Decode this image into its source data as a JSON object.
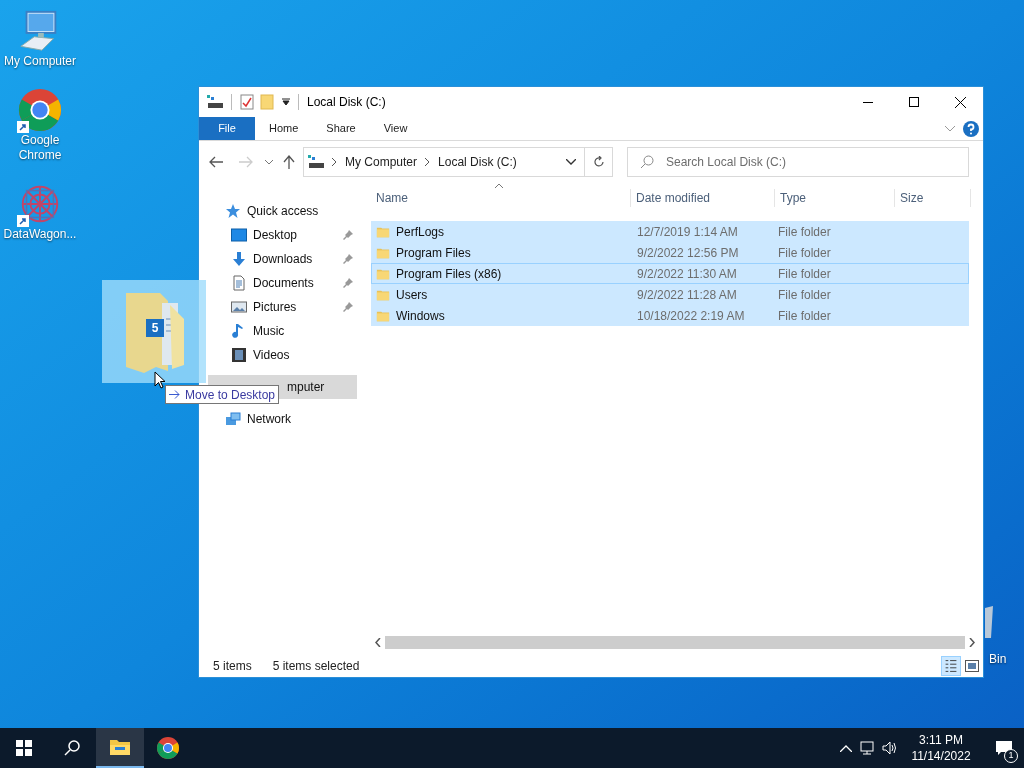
{
  "desktop_icons": [
    {
      "kind": "computer",
      "label": "My Computer"
    },
    {
      "kind": "chrome",
      "label": "Google Chrome"
    },
    {
      "kind": "datawagon",
      "label": "DataWagon..."
    }
  ],
  "recycle_bin": {
    "label": "Bin"
  },
  "window": {
    "title": "Local Disk (C:)",
    "ribbon_tabs": [
      {
        "label": "File",
        "selected": true
      },
      {
        "label": "Home",
        "selected": false
      },
      {
        "label": "Share",
        "selected": false
      },
      {
        "label": "View",
        "selected": false
      }
    ],
    "breadcrumbs": [
      "My Computer",
      "Local Disk (C:)"
    ],
    "search": {
      "placeholder": "Search Local Disk (C:)"
    },
    "nav": [
      {
        "kind": "star",
        "label": "Quick access",
        "selected": false,
        "children": [
          {
            "kind": "desktop",
            "label": "Desktop",
            "pinned": true,
            "selected": false
          },
          {
            "kind": "download",
            "label": "Downloads",
            "pinned": true,
            "selected": false
          },
          {
            "kind": "document",
            "label": "Documents",
            "pinned": true,
            "selected": false
          },
          {
            "kind": "pictures",
            "label": "Pictures",
            "pinned": true,
            "selected": false
          },
          {
            "kind": "music",
            "label": "Music",
            "pinned": false,
            "selected": false
          },
          {
            "kind": "videos",
            "label": "Videos",
            "pinned": false,
            "selected": false
          }
        ]
      },
      {
        "label": "mputer",
        "selected": true
      },
      {
        "kind": "network",
        "label": "Network",
        "selected": false
      }
    ],
    "columns": [
      "Name",
      "Date modified",
      "Type",
      "Size"
    ],
    "rows": [
      {
        "name": "PerfLogs",
        "date": "12/7/2019 1:14 AM",
        "type": "File folder",
        "selected": true,
        "focused": false
      },
      {
        "name": "Program Files",
        "date": "9/2/2022 12:56 PM",
        "type": "File folder",
        "selected": true,
        "focused": false
      },
      {
        "name": "Program Files (x86)",
        "date": "9/2/2022 11:30 AM",
        "type": "File folder",
        "selected": true,
        "focused": true
      },
      {
        "name": "Users",
        "date": "9/2/2022 11:28 AM",
        "type": "File folder",
        "selected": true,
        "focused": false
      },
      {
        "name": "Windows",
        "date": "10/18/2022 2:19 AM",
        "type": "File folder",
        "selected": true,
        "focused": false
      }
    ],
    "status": {
      "count": "5 items",
      "selection": "5 items selected"
    }
  },
  "drag": {
    "badge": "5",
    "tooltip": "Move to Desktop"
  },
  "taskbar": {
    "apps": [
      {
        "kind": "explorer",
        "active": true
      },
      {
        "kind": "chrome",
        "active": false
      }
    ],
    "time": "3:11 PM",
    "date": "11/14/2022",
    "notifications": "1"
  }
}
